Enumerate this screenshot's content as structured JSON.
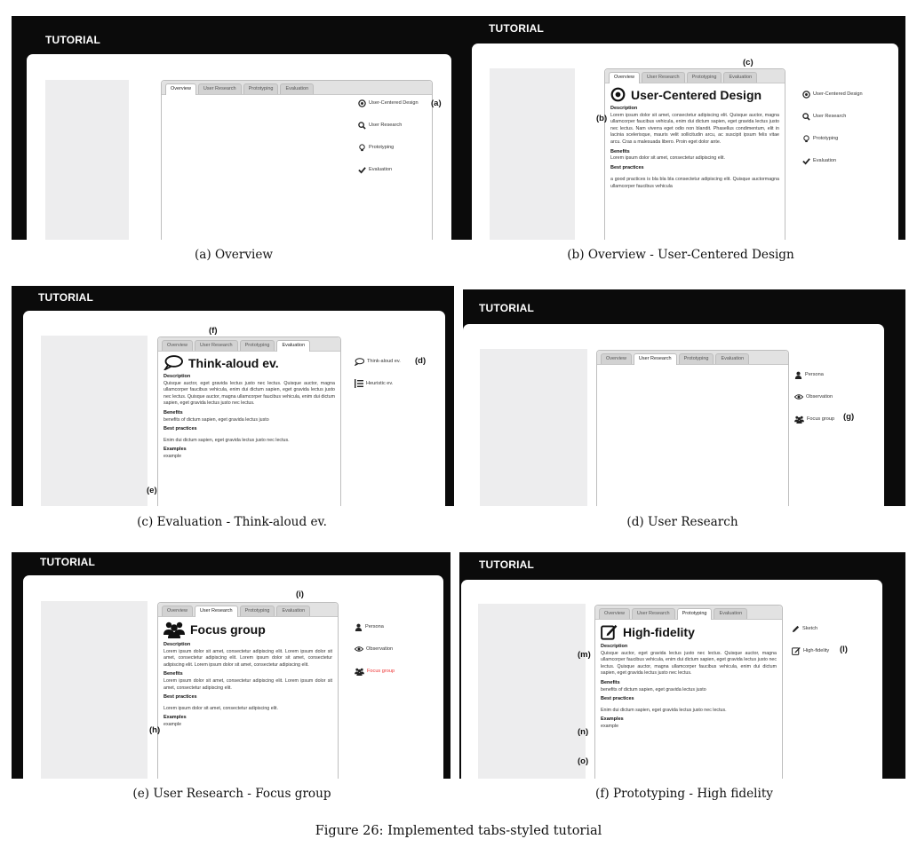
{
  "app_title": "TUTORIAL",
  "tabs": [
    "Overview",
    "User Research",
    "Prototyping",
    "Evaluation"
  ],
  "nav": {
    "overview": [
      {
        "icon": "target-icon",
        "label": "User-Centered Design"
      },
      {
        "icon": "search-icon",
        "label": "User Research"
      },
      {
        "icon": "bulb-icon",
        "label": "Prototyping"
      },
      {
        "icon": "check-icon",
        "label": "Evaluation"
      }
    ],
    "user_research": [
      {
        "icon": "person-icon",
        "label": "Persona"
      },
      {
        "icon": "eye-icon",
        "label": "Observation"
      },
      {
        "icon": "group-icon",
        "label": "Focus group"
      }
    ],
    "evaluation": [
      {
        "icon": "speech-bubble-icon",
        "label": "Think-aloud ev."
      },
      {
        "icon": "list-icon",
        "label": "Heuristic ev."
      }
    ],
    "prototyping": [
      {
        "icon": "pencil-icon",
        "label": "Sketch"
      },
      {
        "icon": "edit-icon",
        "label": "High-fidelity"
      }
    ]
  },
  "labels": {
    "description": "Description",
    "benefits": "Benefits",
    "best_practices": "Best practices",
    "examples": "Examples"
  },
  "panels": {
    "ucd": {
      "title": "User-Centered Design",
      "description": "Lorem ipsum dolor sit amet, consectetur adipiscing elit. Quisque auctor, magna ullamcorper faucibus vehicula, enim dui dictum sapien, eget gravida lectus justo nec lectus. Nam viverra eget odio non blandit. Phasellus condimentum, elit in lacinia scelerisque, mauris velit sollicitudin arcu, ac suscipit ipsum felis vitae arcu. Cras a malesuada libero. Proin eget dolor ante.",
      "benefits": "Lorem ipsum dolor sit amet, consectetur adipiscing elit.",
      "best_practices": "a good practices is bla bla bla consectetur adipiscing elit. Quisque auctormagna ullamcorper faucibus vehicula"
    },
    "think_aloud": {
      "title": "Think-aloud ev.",
      "description": "Quisque auctor, eget gravida lectus justo nec lectus. Quisque auctor, magna ullamcorper faucibus vehicula, enim dui dictum sapien, eget gravida lectus justo nec lectus. Quisque auctor, magna ullamcorper faucibus vehicula, enim dui dictum sapien, eget gravida lectus justo nec lectus.",
      "benefits": "benefits of dictum sapien, eget gravida lectus justo",
      "best_practices": "Enim dui dictum sapien, eget gravida lectus justo nec lectus.",
      "examples": "example"
    },
    "focus_group": {
      "title": "Focus group",
      "description": "Lorem ipsum dolor sit amet, consectetur adipiscing elit. Lorem ipsum dolor sit amet, consectetur adipiscing elit. Lorem ipsum dolor sit amet, consectetur adipiscing elit. Lorem ipsum dolor sit amet, consectetur adipiscing elit.",
      "benefits": "Lorem ipsum dolor sit amet, consectetur adipiscing elit. Lorem ipsum dolor sit amet, consectetur adipiscing elit.",
      "best_practices": "Lorem ipsum dolor sit amet, consectetur adipiscing elit.",
      "examples": "example"
    },
    "high_fidelity": {
      "title": "High-fidelity",
      "description": "Quisque auctor, eget gravida lectus justo nec lectus. Quisque auctor, magna ullamcorper faucibus vehicula, enim dui dictum sapien, eget gravida lectus justo nec lectus. Quisque auctor, magna ullamcorper faucibus vehicula, enim dui dictum sapien, eget gravida lectus justo nec lectus.",
      "benefits": "benefits of dictum sapien, eget gravida lectus justo",
      "best_practices": "Enim dui dictum sapien, eget gravida lectus justo nec lectus.",
      "examples": "example"
    }
  },
  "markers": {
    "a": "(a)",
    "b": "(b)",
    "c": "(c)",
    "d": "(d)",
    "e": "(e)",
    "f": "(f)",
    "g": "(g)",
    "h": "(h)",
    "i": "(i)",
    "l": "(l)",
    "m": "(m)",
    "n": "(n)",
    "o": "(o)"
  },
  "captions": {
    "a": "(a) Overview",
    "b": "(b) Overview - User-Centered Design",
    "c": "(c) Evaluation - Think-aloud ev.",
    "d": "(d) User Research",
    "e": "(e) User Research - Focus group",
    "f": "(f) Prototyping - High fidelity"
  },
  "figure_caption": "Figure 26: Implemented tabs-styled tutorial"
}
